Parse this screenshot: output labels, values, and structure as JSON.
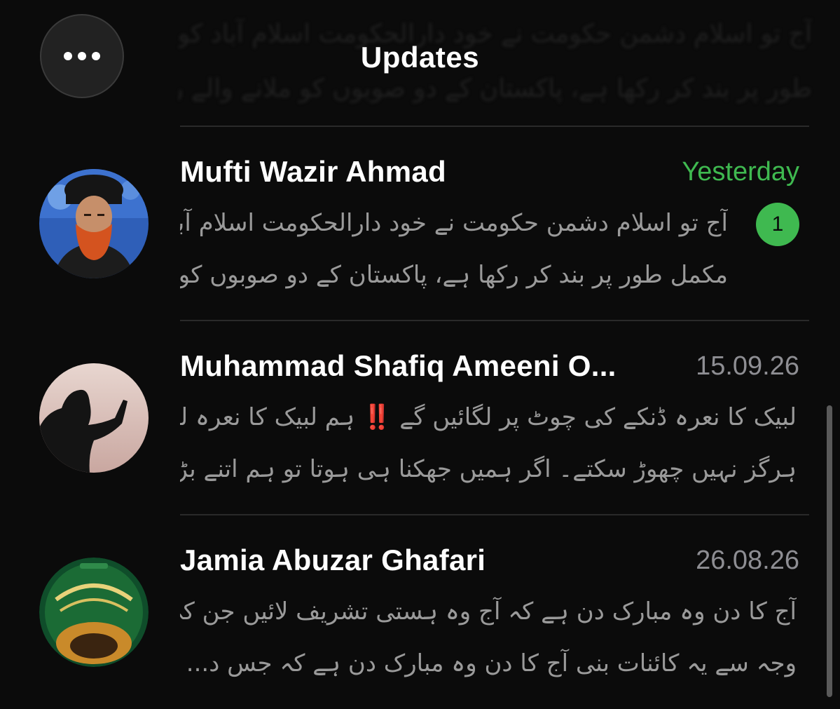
{
  "header": {
    "title": "Updates",
    "faded_line_1": "آج تو اسلام دشمن حکومت نے خود دارالحکومت اسلام آباد کو مکمل",
    "faded_line_2": "طور پر بند کر رکھا ہے، پاکستان کے دو صوبوں کو ملانے والے راستو..."
  },
  "menu_button": {
    "icon": "ellipsis-icon"
  },
  "chats": [
    {
      "name": "Mufti Wazir Ahmad",
      "date": "Yesterday",
      "unread": true,
      "badge": "1",
      "preview_line_1": "آج تو اسلام دشمن حکومت نے خود دارالحکومت اسلام آباد کو",
      "preview_line_2": "مکمل طور پر بند کر رکھا ہے، پاکستان کے دو صوبوں کو ملانے...",
      "avatar": "portrait-turban-red-beard"
    },
    {
      "name": "Muhammad Shafiq Ameeni O...",
      "date": "15.09.26",
      "unread": false,
      "preview_line_1a": "لبیک کا نعرہ ڈنکے کی چوٹ پر لگائیں گے",
      "preview_line_1_emoji": "‼️",
      "preview_line_1b": "ہم لبیک کا نعرہ لگانا",
      "preview_line_2": "ہرگز نہیں چھوڑ سکتے۔ اگر ہمیں جھکنا ہی ہوتا تو ہم اتنے بڑے ریاست...",
      "avatar": "silhouette-praying-sunset"
    },
    {
      "name": "Jamia Abuzar Ghafari",
      "date": "26.08.26",
      "unread": false,
      "preview_line_1": "آج کا دن وہ مبارک دن ہے کہ آج وہ ہستی تشریف لائیں جن کی",
      "preview_line_2": "وجہ سے یہ کائنات بنی آج کا دن وہ مبارک دن ہے کہ جس د...",
      "avatar": "green-emblem-logo"
    }
  ],
  "colors": {
    "background": "#0b0b0b",
    "accent_green": "#3fb950",
    "muted_text": "#8e8e93",
    "preview_text": "#9a9a9a"
  }
}
